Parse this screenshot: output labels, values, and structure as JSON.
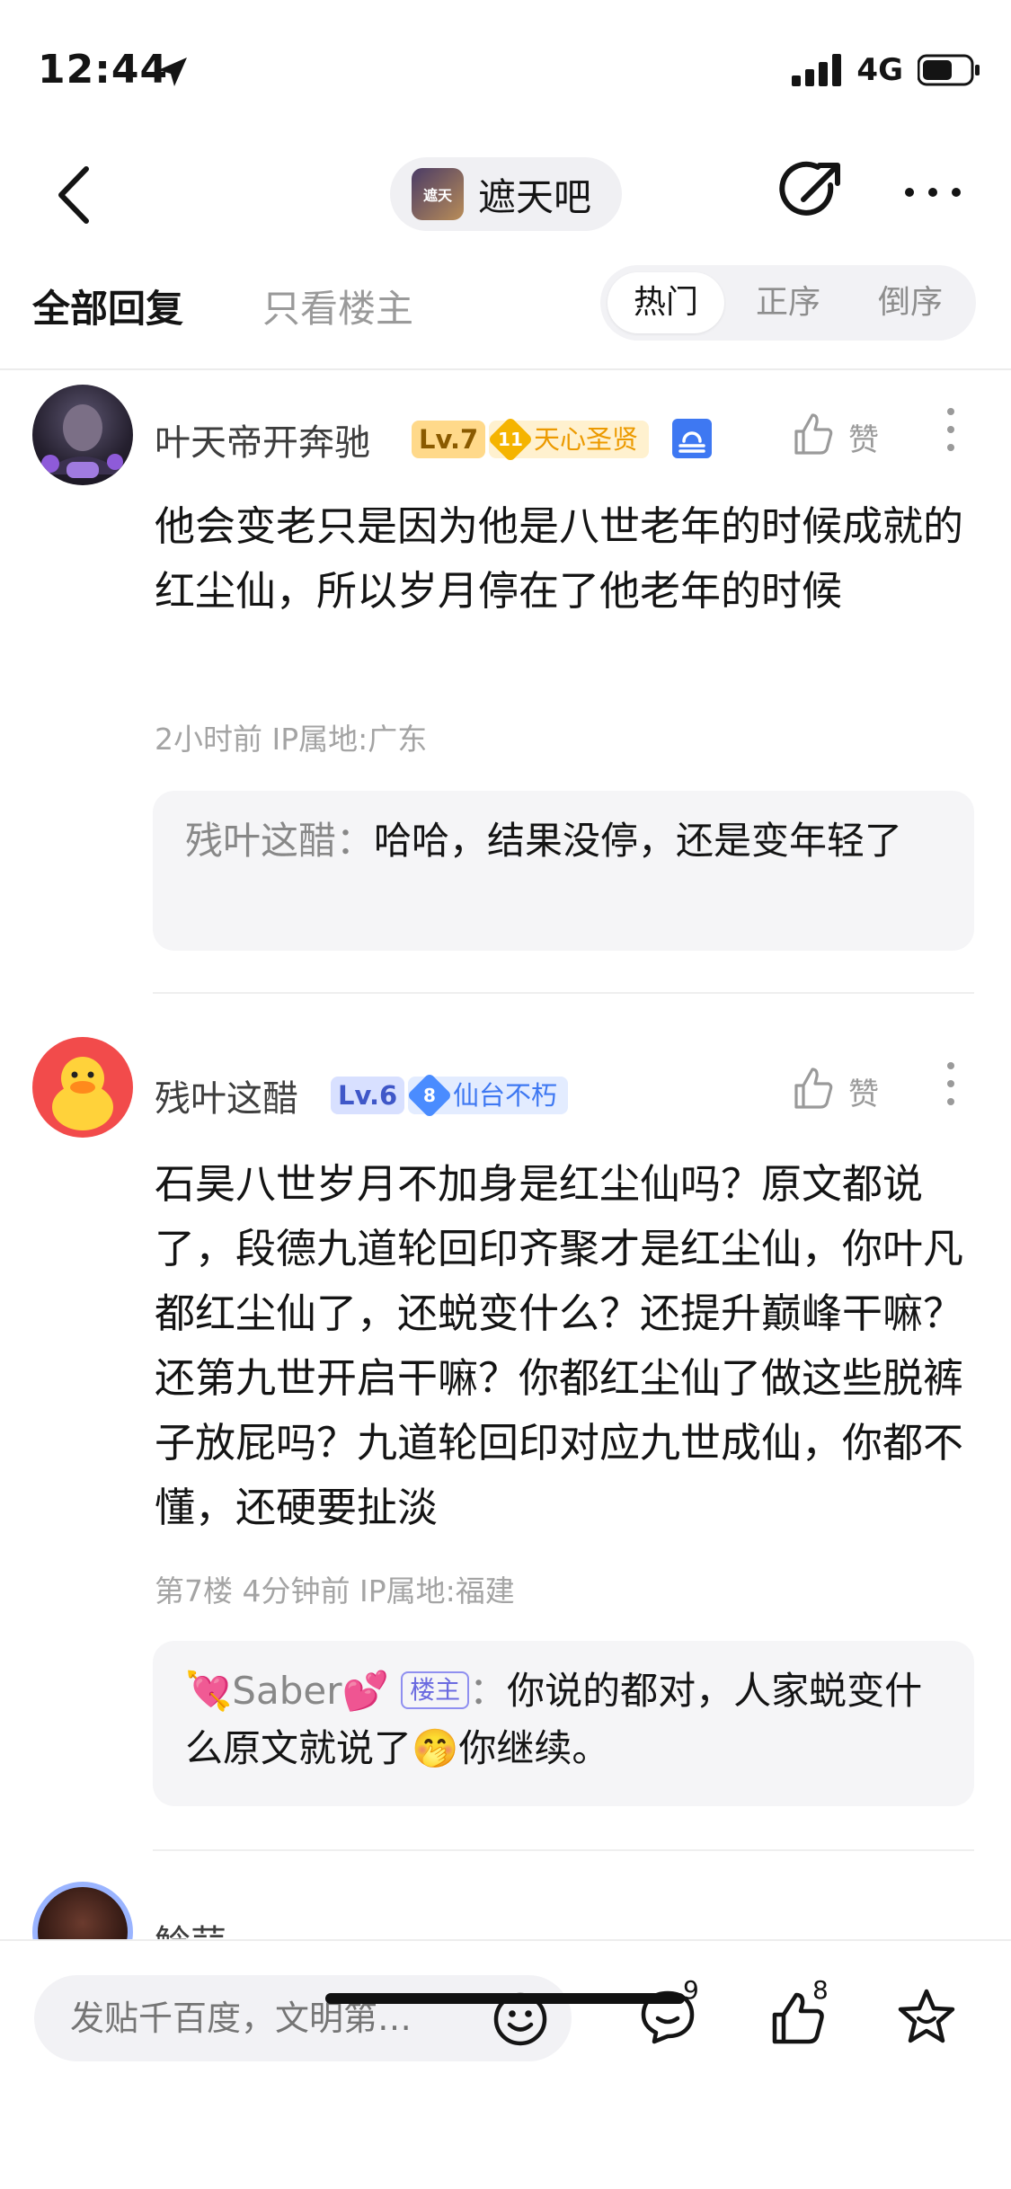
{
  "status": {
    "time": "12:44",
    "network": "4G"
  },
  "nav": {
    "forum_name": "遮天吧",
    "forum_avatar_text": "遮天"
  },
  "tabs": {
    "all": "全部回复",
    "op_only": "只看楼主"
  },
  "sort": {
    "hot": "热门",
    "asc": "正序",
    "desc": "倒序",
    "active": "hot"
  },
  "comments": [
    {
      "user": "叶天帝开奔驰",
      "level": "Lv.7",
      "badge_num": "11",
      "badge_title": "天心圣贤",
      "like_label": "赞",
      "text": "他会变老只是因为他是八世老年的时候成就的红尘仙，所以岁月停在了他老年的时候",
      "meta": "2小时前   IP属地:广东",
      "reply": {
        "name": "残叶这醋",
        "sep": "：",
        "text": "哈哈，结果没停，还是变年轻了"
      }
    },
    {
      "user": "残叶这醋",
      "level": "Lv.6",
      "badge_num": "8",
      "badge_title": "仙台不朽",
      "like_label": "赞",
      "text": "石昊八世岁月不加身是红尘仙吗？原文都说了，段德九道轮回印齐聚才是红尘仙，你叶凡都红尘仙了，还蜕变什么？还提升巅峰干嘛？还第九世开启干嘛？你都红尘仙了做这些脱裤子放屁吗？九道轮回印对应九世成仙，你都不懂，还硬要扯淡",
      "meta": "第7楼   4分钟前   IP属地:福建",
      "reply": {
        "name_prefix": "💘",
        "name": "Saber",
        "name_suffix": "💕",
        "op_tag": "楼主",
        "sep": "：",
        "text": "你说的都对，人家蜕变什么原文就说了",
        "emoji": "🤭",
        "text2": "你继续。"
      }
    },
    {
      "user": "鲶蒜"
    }
  ],
  "bottom": {
    "input_placeholder": "发贴千百度，文明第…",
    "comment_count": "9",
    "like_count": "8"
  }
}
